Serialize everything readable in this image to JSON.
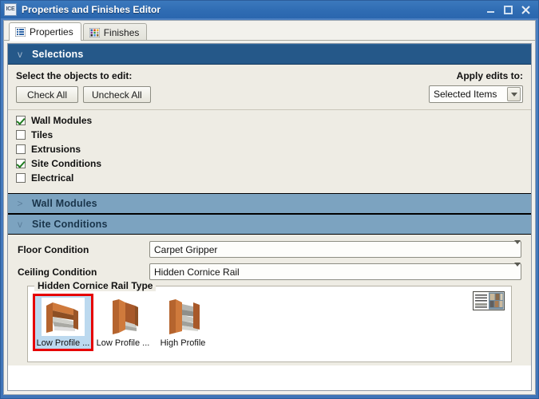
{
  "window": {
    "title": "Properties and Finishes Editor",
    "app_icon": "ICE",
    "minimize_label": "Minimize",
    "maximize_label": "Maximize",
    "close_label": "Close"
  },
  "tabs": [
    {
      "label": "Properties",
      "icon": "list-icon",
      "active": true
    },
    {
      "label": "Finishes",
      "icon": "color-grid-icon",
      "active": false
    }
  ],
  "sections": {
    "selections": {
      "title": "Selections",
      "chevron": "v",
      "expanded": true,
      "prompt": "Select the objects to edit:",
      "check_all_label": "Check All",
      "uncheck_all_label": "Uncheck All",
      "apply_label": "Apply edits to:",
      "apply_value": "Selected Items",
      "objects": [
        {
          "label": "Wall Modules",
          "checked": true
        },
        {
          "label": "Tiles",
          "checked": false
        },
        {
          "label": "Extrusions",
          "checked": false
        },
        {
          "label": "Site Conditions",
          "checked": true
        },
        {
          "label": "Electrical",
          "checked": false
        }
      ]
    },
    "wall_modules": {
      "title": "Wall Modules",
      "chevron": ">",
      "expanded": false
    },
    "site_conditions": {
      "title": "Site Conditions",
      "chevron": "v",
      "expanded": true,
      "fields": [
        {
          "label": "Floor Condition",
          "value": "Carpet Gripper"
        },
        {
          "label": "Ceiling Condition",
          "value": "Hidden Cornice Rail"
        }
      ],
      "group": {
        "title": "Hidden Cornice Rail Type",
        "view_toggle_icon": "list-grid-view-icon",
        "items": [
          {
            "caption": "Low Profile ...",
            "selected": true
          },
          {
            "caption": "Low Profile ...",
            "selected": false
          },
          {
            "caption": "High Profile",
            "selected": false
          }
        ]
      }
    }
  },
  "colors": {
    "title_bar": "#2f6cb3",
    "section_header_primary": "#255889",
    "section_header_sub": "#7ca3c0",
    "panel_background": "#eeece4",
    "selection_outline": "#e60000",
    "selection_fill": "#bcd9ef",
    "check_color": "#1e7b1e"
  }
}
